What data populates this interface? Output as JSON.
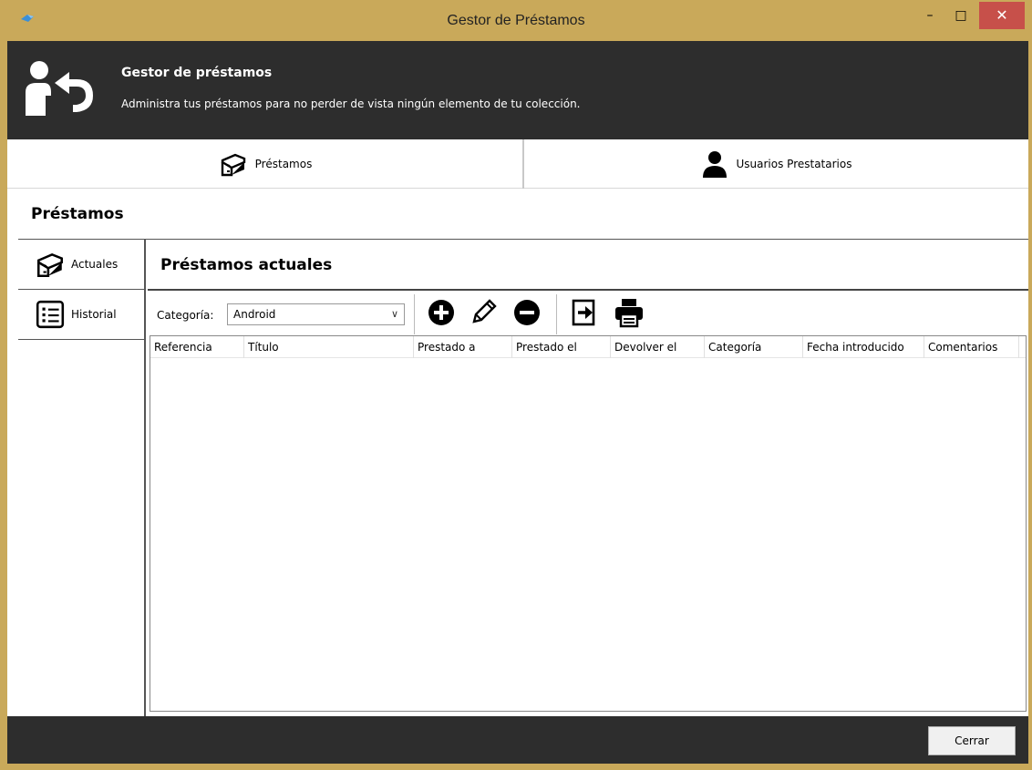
{
  "window": {
    "title": "Gestor de Préstamos",
    "min_glyph": "–",
    "max_glyph": "□",
    "close_glyph": "✕"
  },
  "header": {
    "title": "Gestor de préstamos",
    "subtitle": "Administra tus préstamos para no perder de vista ningún elemento de tu colección.",
    "icon": "lender-return-icon"
  },
  "tabs": [
    {
      "label": "Préstamos",
      "icon": "box-icon"
    },
    {
      "label": "Usuarios Prestatarios",
      "icon": "user-icon"
    }
  ],
  "section": {
    "title": "Préstamos"
  },
  "sidebar": {
    "items": [
      {
        "label": "Actuales",
        "icon": "box-icon"
      },
      {
        "label": "Historial",
        "icon": "list-icon"
      }
    ]
  },
  "panel": {
    "title": "Préstamos actuales"
  },
  "toolbar": {
    "category_label": "Categoría:",
    "category_value": "Android",
    "buttons": [
      "add-icon",
      "edit-icon",
      "remove-icon",
      "return-icon",
      "print-icon"
    ]
  },
  "grid": {
    "columns": [
      "Referencia",
      "Título",
      "Prestado a",
      "Prestado el",
      "Devolver el",
      "Categoría",
      "Fecha introducido",
      "Comentarios"
    ],
    "rows": []
  },
  "footer": {
    "close_label": "Cerrar"
  },
  "colors": {
    "frame": "#c9a95a",
    "header_bg": "#2d2d2d",
    "close_btn": "#c7504a"
  }
}
